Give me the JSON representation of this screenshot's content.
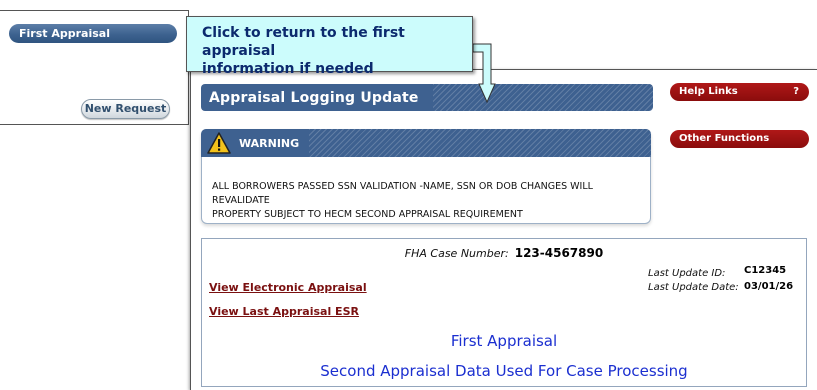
{
  "back_window": {
    "side_tab_label": "First Appraisal",
    "new_request_label": "New Request"
  },
  "callout": {
    "line1": "Click to return to the first appraisal",
    "line2": "information if needed"
  },
  "main": {
    "title": "Appraisal Logging Update",
    "warning": {
      "header": "WARNING",
      "lines": [
        "ALL BORROWERS PASSED SSN VALIDATION -NAME, SSN OR DOB CHANGES WILL",
        "REVALIDATE",
        "PROPERTY SUBJECT TO HECM SECOND APPRAISAL REQUIREMENT"
      ]
    },
    "case": {
      "fha_label": "FHA Case Number:",
      "fha_value": "123-4567890",
      "last_update_id_label": "Last Update ID:",
      "last_update_id_value": "C12345",
      "last_update_date_label": "Last Update Date:",
      "last_update_date_value": "03/01/26",
      "link_electronic": "View Electronic Appraisal",
      "link_esr": "View Last Appraisal ESR",
      "first_appraisal": "First Appraisal",
      "second_appraisal": "Second Appraisal Data Used For Case Processing"
    }
  },
  "right_panel": {
    "help_links_label": "Help Links",
    "help_links_icon": "?",
    "other_functions_label": "Other Functions"
  },
  "colors": {
    "header_blue": "#3e6190",
    "button_red": "#8a0c0c",
    "callout_bg": "#ccfcfc",
    "link_color": "#7a1010",
    "appraisal_text": "#1b2fd0"
  }
}
